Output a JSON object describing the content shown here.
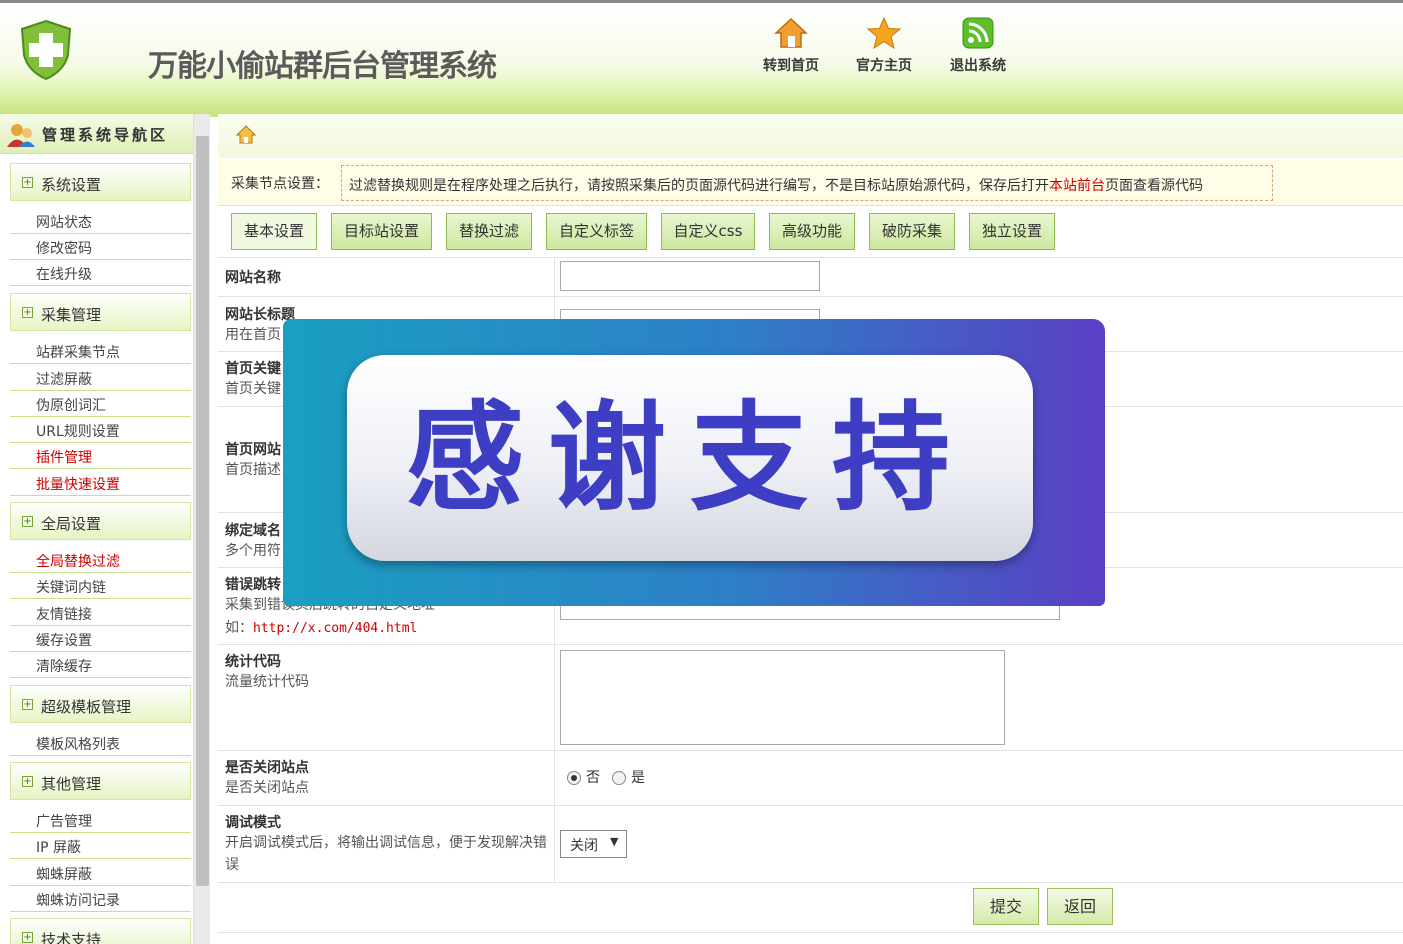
{
  "header": {
    "title": "万能小偷站群后台管理系统",
    "nav": [
      {
        "label": "转到首页",
        "icon": "home-icon"
      },
      {
        "label": "官方主页",
        "icon": "star-icon"
      },
      {
        "label": "退出系统",
        "icon": "rss-icon"
      }
    ]
  },
  "sidebar": {
    "title": "管理系统导航区",
    "groups": [
      {
        "label": "系统设置",
        "items": [
          "网站状态",
          "修改密码",
          "在线升级"
        ]
      },
      {
        "label": "采集管理",
        "items": [
          "站群采集节点",
          "过滤屏蔽",
          "伪原创词汇",
          "URL规则设置",
          "插件管理",
          "批量快速设置"
        ]
      },
      {
        "label": "全局设置",
        "items": [
          "全局替换过滤",
          "关键词内链",
          "友情链接",
          "缓存设置",
          "清除缓存"
        ]
      },
      {
        "label": "超级模板管理",
        "items": [
          "模板风格列表"
        ]
      },
      {
        "label": "其他管理",
        "items": [
          "广告管理",
          "IP 屏蔽",
          "蜘蛛屏蔽",
          "蜘蛛访问记录"
        ]
      },
      {
        "label": "技术支持",
        "items": []
      }
    ]
  },
  "tip": {
    "label": "采集节点设置：",
    "text_before": "过滤替换规则是在程序处理之后执行，请按照采集后的页面源代码进行编写，不是目标站原始源代码，保存后打开",
    "link": "本站前台",
    "text_after": "页面查看源代码"
  },
  "tabs": [
    "基本设置",
    "目标站设置",
    "替换过滤",
    "自定义标签",
    "自定义css",
    "高级功能",
    "破防采集",
    "独立设置"
  ],
  "form": {
    "site_name": {
      "label": "网站名称",
      "value": ""
    },
    "long_title": {
      "label": "网站长标题",
      "desc": "用在首页"
    },
    "keywords": {
      "label": "首页关键",
      "desc": "首页关键"
    },
    "description": {
      "label": "首页网站",
      "desc": "首页描述"
    },
    "domain": {
      "label": "绑定域名",
      "desc": "多个用符"
    },
    "error_jump": {
      "label": "错误跳转",
      "desc": "采集到错误页后跳转的自定义地址",
      "example_prefix": "如：",
      "example_url": "http://x.com/404.html"
    },
    "stats": {
      "label": "统计代码",
      "desc": "流量统计代码"
    },
    "close_site": {
      "label": "是否关闭站点",
      "desc": "是否关闭站点",
      "opt_no": "否",
      "opt_yes": "是",
      "selected": "否"
    },
    "debug": {
      "label": "调试模式",
      "desc": "开启调试模式后，将输出调试信息，便于发现解决错误",
      "value": "关闭"
    }
  },
  "buttons": {
    "submit": "提交",
    "back": "返回"
  },
  "overlay": {
    "text": "感谢支持"
  }
}
